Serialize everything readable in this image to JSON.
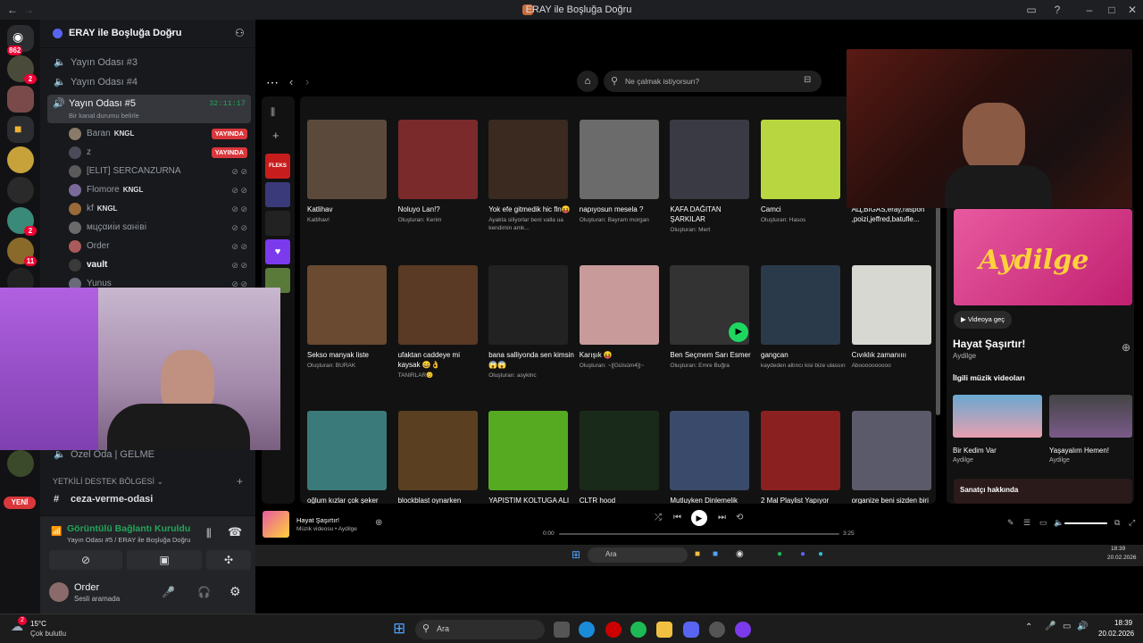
{
  "window": {
    "title": "ERAY ile Boşluğa Doğru"
  },
  "rail": {
    "top_badge": "862",
    "badges": [
      "2",
      "2",
      "11"
    ],
    "new_label": "YENİ"
  },
  "server": {
    "name": "ERAY ile Boşluğa Doğru"
  },
  "channels": [
    {
      "name": "Yayın Odası #3"
    },
    {
      "name": "Yayın Odası #4"
    }
  ],
  "active_channel": {
    "name": "Yayın Odası #5",
    "timer": "32:11:17",
    "status": "Bir kanal durumu belirle"
  },
  "members": [
    {
      "name": "Baran",
      "tag": "KNGL",
      "live": "YAYINDA"
    },
    {
      "name": "z",
      "tag": "",
      "live": "YAYINDA"
    },
    {
      "name": "[ELIT] SERCANZURNA",
      "tag": "",
      "live": ""
    },
    {
      "name": "Flomore",
      "tag": "KNGL",
      "live": ""
    },
    {
      "name": "kf",
      "tag": "KNGL",
      "live": ""
    },
    {
      "name": "мцҫαиı̇и ѕαнı̇вı̇",
      "tag": "",
      "live": ""
    },
    {
      "name": "Order",
      "tag": "",
      "live": ""
    },
    {
      "name": "vault",
      "tag": "",
      "live": ""
    },
    {
      "name": "Yunus",
      "tag": "",
      "live": ""
    }
  ],
  "lower_channels": {
    "private": "Özel Oda | GELME",
    "category": "YETKİLİ DESTEK BÖLGESİ",
    "text_channel": "ceza-verme-odasi"
  },
  "voice_status": {
    "title": "Görüntülü Bağlantı Kuruldu",
    "subtitle": "Yayın Odası #5 / ERAY ile Boşluğa Doğru"
  },
  "user": {
    "name": "Order",
    "status": "Sesli aramada"
  },
  "spotify": {
    "search_placeholder": "Ne çalmak istiyorsun?",
    "row1": [
      {
        "name": "Katlihav",
        "sub": "Katlihav!",
        "color": "#5b4a3c"
      },
      {
        "name": "Noluyo Lan!?",
        "sub": "Oluşturan: Kerim",
        "color": "#7a2a2a"
      },
      {
        "name": "Yok efe gitmedik hic fln😝",
        "sub": "Ayakta siliyorlar beni valla ua kendimin amk...",
        "color": "#3a2a20"
      },
      {
        "name": "napıyosun mesela ?",
        "sub": "Oluşturan: Bayram morgan",
        "color": "#6b6b6b"
      },
      {
        "name": "KAFA DAĞITAN ŞARKILAR",
        "sub": "Oluşturan: Mert",
        "color": "#3a3a44"
      },
      {
        "name": "Camci",
        "sub": "Oluşturan: Hasos",
        "color": "#b8d640"
      },
      {
        "name": "АЦ,BIGAS,eray,raspon ,poizi,jeffred,batufle...",
        "sub": "",
        "color": "#2b2b2b"
      }
    ],
    "row2": [
      {
        "name": "Sekso manyak liste",
        "sub": "Oluşturan: BURAK",
        "color": "#6a4a30"
      },
      {
        "name": "ufaktan caddeye mi kaysak 😄👌",
        "sub": "TANIRLAR😊",
        "color": "#5a3a24"
      },
      {
        "name": "bana salliyonda sen kimsin 😱😱",
        "sub": "Oluşturan: asyklnc",
        "color": "#222"
      },
      {
        "name": "Karışık 😝",
        "sub": "Oluşturan: ~|[Gülsüm4]|~",
        "color": "#c99a9a"
      },
      {
        "name": "Ben Seçmem Sarı Esmer",
        "sub": "Oluşturan: Emre Buğra",
        "color": "#333"
      },
      {
        "name": "gangcan",
        "sub": "kaydeden altıncı kisi bize ulassın",
        "color": "#2a3a4a"
      },
      {
        "name": "Cıvıklık zamanıııı",
        "sub": "Aboooooooooo",
        "color": "#d8d8d2"
      }
    ],
    "row3": [
      {
        "name": "oğlum kızlar çok şeker",
        "sub": "",
        "color": "#3a7a7a"
      },
      {
        "name": "blockblast oynarken dinlencek şarkılar:)",
        "sub": "",
        "color": "#5a4020"
      },
      {
        "name": "YAPISTIM KOLTUGA ALI KOÇ GİBİ",
        "sub": "",
        "color": "#55aa22"
      },
      {
        "name": "CLTR hood",
        "sub": "",
        "color": "#1a2a1a"
      },
      {
        "name": "Mutluyken Dinlemelik",
        "sub": "",
        "color": "#3a4a6a"
      },
      {
        "name": "2 Mal Playlist Yapıyor",
        "sub": "",
        "color": "#8a2020"
      },
      {
        "name": "organize beni sizden biri",
        "sub": "",
        "color": "#5a5a6a"
      }
    ],
    "right": {
      "video_btn": "Videoya geç",
      "song_title": "Hayat Şaşırtır!",
      "artist": "Aydilge",
      "section": "İlgili müzik videoları",
      "banner_text": "Aydilge",
      "videos": [
        {
          "title": "Bir Kedim Var",
          "artist": "Aydilge"
        },
        {
          "title": "Yaşayalım Hemen!",
          "artist": "Aydilge"
        }
      ],
      "about": "Sanatçı hakkında"
    },
    "now_playing": {
      "title": "Hayat Şaşırtır!",
      "sub": "Müzik videosu • Aydilge",
      "time_cur": "0:00",
      "time_total": "3:25"
    },
    "inner_taskbar": {
      "search": "Ara",
      "time": "18:39",
      "date": "20.02.2026"
    },
    "lib_label": "FLEKS"
  },
  "taskbar": {
    "weather_temp": "15°C",
    "weather_desc": "Çok bulutlu",
    "search": "Ara",
    "time": "18:39",
    "date": "20.02.2026",
    "weather_badge": "2"
  }
}
